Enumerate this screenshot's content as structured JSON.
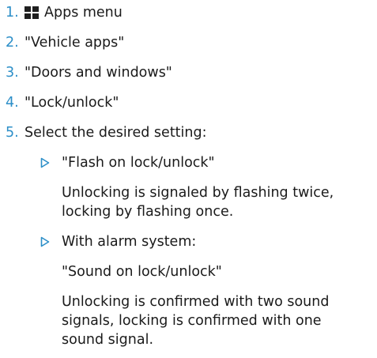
{
  "steps": [
    {
      "number": "1.",
      "icon": "apps-grid-icon",
      "text": "Apps menu"
    },
    {
      "number": "2.",
      "text": "\"Vehicle apps\""
    },
    {
      "number": "3.",
      "text": "\"Doors and windows\""
    },
    {
      "number": "4.",
      "text": "\"Lock/unlock\""
    },
    {
      "number": "5.",
      "text": "Select the desired setting:"
    }
  ],
  "options": [
    {
      "bullet_icon": "triangle-right-icon",
      "title": "\"Flash on lock/unlock\"",
      "description_lines": [
        "Unlocking is signaled by flashing twice,",
        "locking by flashing once."
      ]
    },
    {
      "bullet_icon": "triangle-right-icon",
      "title": "With alarm system:",
      "setting": "\"Sound on lock/unlock\"",
      "description_lines": [
        "Unlocking is confirmed with two sound",
        "signals, locking is confirmed with one",
        "sound signal."
      ]
    }
  ],
  "colors": {
    "step_number": "#2d8fc8",
    "bullet": "#2d8fc8",
    "text": "#1a1a1a"
  }
}
